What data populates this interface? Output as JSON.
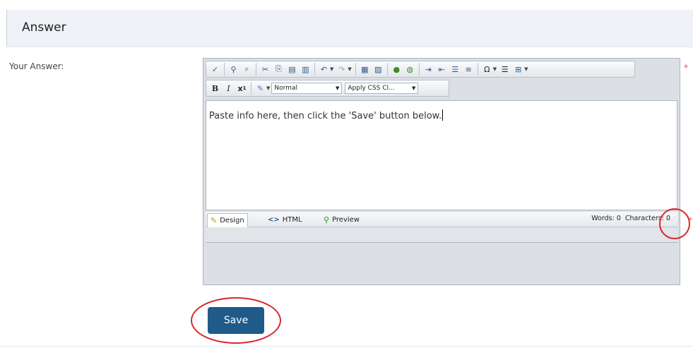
{
  "section": {
    "title": "Answer"
  },
  "form": {
    "label": "Your Answer:",
    "required_mark": "*"
  },
  "editor": {
    "toolbar_row1": [
      {
        "icon": "spellcheck-icon"
      },
      {
        "icon": "find-icon"
      },
      {
        "icon": "cut-icon"
      },
      {
        "icon": "copy-icon"
      },
      {
        "icon": "paste-icon"
      },
      {
        "icon": "paste-text-icon"
      },
      {
        "icon": "undo-icon"
      },
      {
        "icon": "redo-icon"
      },
      {
        "icon": "image-manager-icon"
      },
      {
        "icon": "insert-image-icon"
      },
      {
        "icon": "hyperlink-icon"
      },
      {
        "icon": "remove-link-icon"
      },
      {
        "icon": "indent-icon"
      },
      {
        "icon": "outdent-icon"
      },
      {
        "icon": "numbered-list-icon"
      },
      {
        "icon": "bullet-list-icon"
      },
      {
        "icon": "special-char-icon"
      },
      {
        "icon": "align-icon"
      },
      {
        "icon": "insert-form-icon"
      }
    ],
    "toolbar_row2": {
      "bold": "B",
      "italic": "I",
      "clear_format": "x",
      "paragraph_style": "Normal",
      "css_class": "Apply CSS Cl..."
    },
    "content": "Paste info here, then click the 'Save' button below.",
    "modes": {
      "design": "Design",
      "html": "HTML",
      "preview": "Preview"
    },
    "stats": {
      "words_label": "Words:",
      "words_value": "0",
      "chars_label": "Characters:",
      "chars_value": "0"
    }
  },
  "actions": {
    "save": "Save"
  },
  "colors": {
    "accent": "#1f5a88",
    "header_bg": "#eef2f7",
    "annotation": "#d8262e",
    "required": "#d9534f"
  }
}
